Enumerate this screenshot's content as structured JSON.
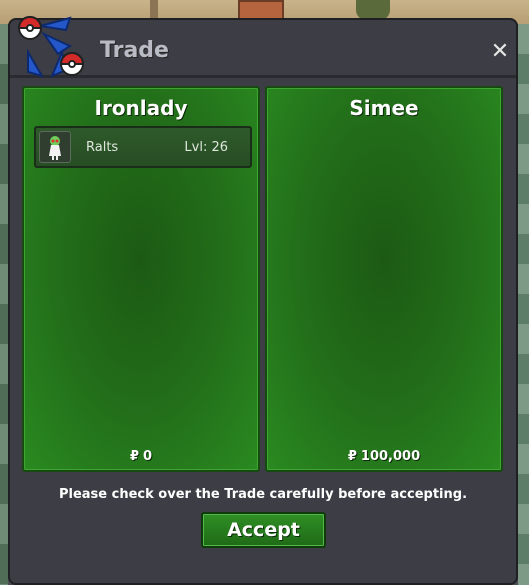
{
  "window": {
    "title": "Trade",
    "close_glyph": "✕"
  },
  "icons": {
    "logo": "pokeball-swap-icon",
    "close": "close-icon",
    "item": "ralts-sprite-icon",
    "currency": "pokedollar-icon"
  },
  "left_panel": {
    "name": "Ironlady",
    "items": [
      {
        "name": "Ralts",
        "level": "Lvl: 26"
      }
    ],
    "currency_symbol": "₽",
    "money": "0"
  },
  "right_panel": {
    "name": "Simee",
    "items": [],
    "currency_symbol": "₽",
    "money": "100,000"
  },
  "notice": "Please check over the Trade carefully before accepting.",
  "accept_label": "Accept",
  "colors": {
    "panel_green": "#23701a",
    "window_bg": "#3d3e45",
    "accent_red": "#d42a2a",
    "accent_blue": "#2457c9"
  }
}
